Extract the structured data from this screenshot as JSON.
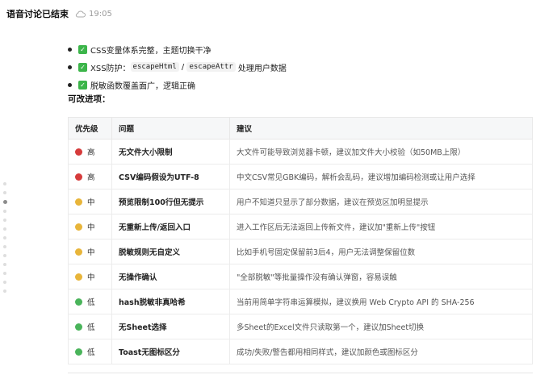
{
  "header": {
    "title": "语音讨论已结束",
    "time": "19:05"
  },
  "checklist": [
    {
      "text": "CSS变量体系完整，主题切换干净"
    },
    {
      "prefix": "XSS防护：",
      "code1": "escapeHtml",
      "sep": " / ",
      "code2": "escapeAttr",
      "suffix": " 处理用户数据"
    },
    {
      "text": "脱敏函数覆盖面广，逻辑正确"
    }
  ],
  "improvements_heading": "可改进项：",
  "table": {
    "headers": [
      "优先级",
      "问题",
      "建议"
    ],
    "rows": [
      {
        "priority": "高",
        "color": "#d63b3b",
        "item": "无文件大小限制",
        "suggestion": "大文件可能导致浏览器卡顿，建议加文件大小校验（如50MB上限）"
      },
      {
        "priority": "高",
        "color": "#d63b3b",
        "item": "CSV编码假设为UTF-8",
        "suggestion": "中文CSV常见GBK编码，解析会乱码，建议增加编码检测或让用户选择"
      },
      {
        "priority": "中",
        "color": "#e8b53a",
        "item": "预览限制100行但无提示",
        "suggestion": "用户不知道只显示了部分数据，建议在预览区加明显提示"
      },
      {
        "priority": "中",
        "color": "#e8b53a",
        "item": "无重新上传/返回入口",
        "suggestion": "进入工作区后无法返回上传新文件，建议加\"重新上传\"按钮"
      },
      {
        "priority": "中",
        "color": "#e8b53a",
        "item": "脱敏规则无自定义",
        "suggestion": "比如手机号固定保留前3后4，用户无法调整保留位数"
      },
      {
        "priority": "中",
        "color": "#e8b53a",
        "item": "无操作确认",
        "suggestion": "\"全部脱敏\"等批量操作没有确认弹窗，容易误触"
      },
      {
        "priority": "低",
        "color": "#49b45a",
        "item": "hash脱敏非真哈希",
        "suggestion": "当前用简单字符串运算模拟，建议换用 Web Crypto API 的 SHA-256"
      },
      {
        "priority": "低",
        "color": "#49b45a",
        "item": "无Sheet选择",
        "suggestion": "多Sheet的Excel文件只读取第一个，建议加Sheet切换"
      },
      {
        "priority": "低",
        "color": "#49b45a",
        "item": "Toast无图标区分",
        "suggestion": "成功/失败/警告都用相同样式，建议加颜色或图标区分"
      }
    ]
  }
}
